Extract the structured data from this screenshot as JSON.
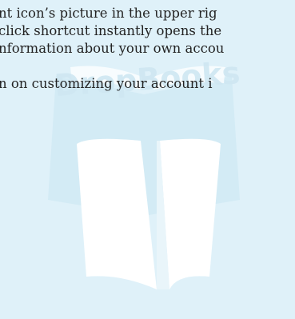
{
  "watermark": {
    "logo_text": "DropBooks",
    "icon": "open-book-logo-icon",
    "colors": {
      "book_pages": "#ffffff",
      "book_shadow": "#cbe6f2",
      "logo_text": "#c9e3ef"
    }
  },
  "body_text": {
    "lines": [
      "nt icon’s picture in the upper rig",
      "click shortcut instantly opens the",
      "nformation about your own accou",
      "n on customizing your account i"
    ]
  }
}
